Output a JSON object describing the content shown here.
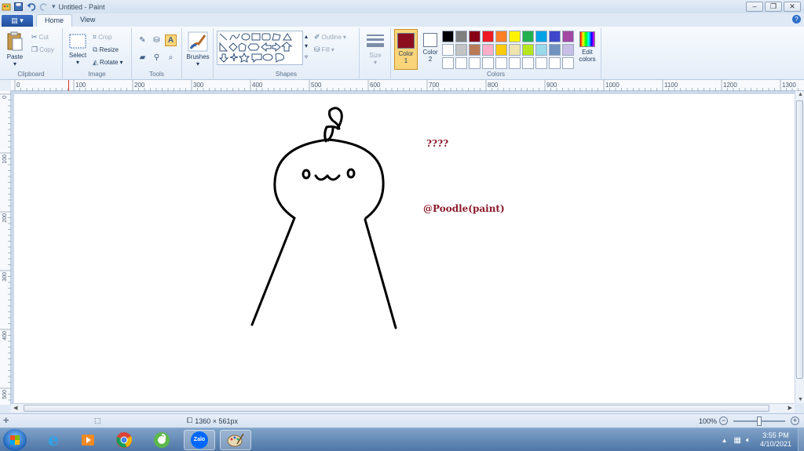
{
  "window": {
    "title": "Untitled - Paint",
    "minimize": "–",
    "restore": "❐",
    "close": "✕"
  },
  "tabs": {
    "file": "▤ ▾",
    "home": "Home",
    "view": "View",
    "help": "?"
  },
  "ribbon": {
    "clipboard": {
      "label": "Clipboard",
      "paste": "Paste",
      "cut": "Cut",
      "copy": "Copy"
    },
    "image": {
      "label": "Image",
      "select": "Select",
      "crop": "Crop",
      "resize": "Resize",
      "rotate": "Rotate"
    },
    "tools": {
      "label": "Tools"
    },
    "brushes": {
      "label": "Brushes"
    },
    "shapes": {
      "label": "Shapes",
      "outline": "Outline",
      "fill": "Fill"
    },
    "size": {
      "label": "Size"
    },
    "colors": {
      "label": "Colors",
      "color1": "Color",
      "color1_num": "1",
      "color2": "Color",
      "color2_num": "2",
      "edit": "Edit",
      "edit2": "colors",
      "color1_value": "#8b0f1e",
      "color2_value": "#ffffff",
      "palette": [
        "#000000",
        "#7f7f7f",
        "#880015",
        "#ed1c24",
        "#ff7f27",
        "#fff200",
        "#22b14c",
        "#00a2e8",
        "#3f48cc",
        "#a349a4",
        "#ffffff",
        "#c3c3c3",
        "#b97a57",
        "#ffaec9",
        "#ffc90e",
        "#efe4b0",
        "#b5e61d",
        "#99d9ea",
        "#7092be",
        "#c8bfe7",
        "#ffffff",
        "#ffffff",
        "#ffffff",
        "#ffffff",
        "#ffffff",
        "#ffffff",
        "#ffffff",
        "#ffffff",
        "#ffffff",
        "#ffffff"
      ]
    }
  },
  "ruler": {
    "h": [
      "0",
      "100",
      "200",
      "300",
      "400",
      "500",
      "600",
      "700",
      "800",
      "900",
      "1000",
      "1100",
      "1200",
      "1300"
    ],
    "v": [
      "0",
      "100",
      "200",
      "300",
      "400",
      "500"
    ]
  },
  "canvas": {
    "text1": "????",
    "text2": "@Poodle(paint)"
  },
  "status": {
    "dimensions": "1360 × 561px",
    "zoom": "100%"
  },
  "taskbar": {
    "zalo": "Zalo",
    "time": "3:55 PM",
    "date": "4/10/2021"
  }
}
